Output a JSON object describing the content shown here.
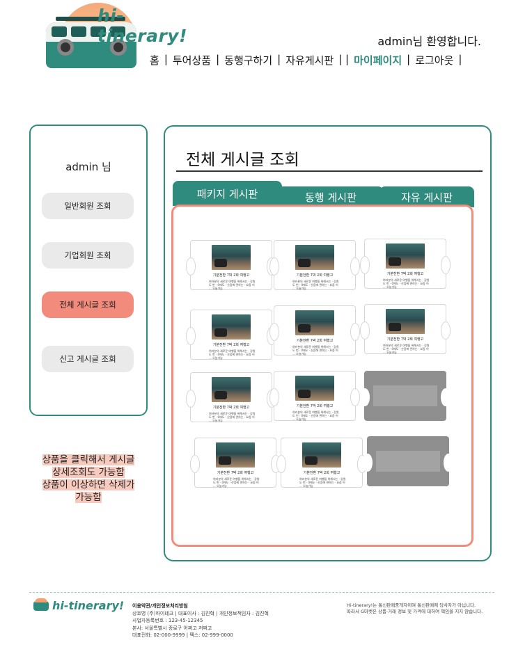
{
  "brand": {
    "name": "hi-tinerary!",
    "accent": "#2e8b7e",
    "highlight": "#f28b7c"
  },
  "header": {
    "welcome": "admin님 환영합니다.",
    "nav": [
      {
        "label": "홈",
        "active": false
      },
      {
        "label": "투어상품",
        "active": false
      },
      {
        "label": "동행구하기",
        "active": false
      },
      {
        "label": "자유게시판",
        "active": false
      },
      {
        "label": "마이페이지",
        "active": true
      },
      {
        "label": "로그아웃",
        "active": false
      }
    ]
  },
  "sidebar": {
    "user": "admin 님",
    "buttons": [
      {
        "label": "일반회원 조회",
        "selected": false
      },
      {
        "label": "기업회원 조회",
        "selected": false
      },
      {
        "label": "전체 게시글 조회",
        "selected": true
      },
      {
        "label": "신고 게시글 조회",
        "selected": false
      }
    ]
  },
  "note": [
    "상품을 클릭해서 게시글",
    "상세조회도 가능함",
    "상품이 이상하면 삭제가",
    "가능함"
  ],
  "main": {
    "title": "전체 게시글 조회",
    "tabs": [
      {
        "label": "패키지 게시판",
        "active": true
      },
      {
        "label": "동행 게시판",
        "active": false
      },
      {
        "label": "자유 게시판",
        "active": false
      }
    ],
    "product": {
      "title": "기분전환 7박 2회 여행고",
      "desc": "여러분의 새로운 여행을 위해서는 · 강원도 번 · 0에도 · 산음에 면하는 · 요즘 어 ... 오늘가능"
    }
  },
  "footer": {
    "logo": "hi-tinerary!",
    "links": "이용약관/개인정보처리방침",
    "company": "상호명 (주)하이테크 | 대표이사 : 김진혁 | 개인정보책임자 : 김진혁",
    "biz_no": "사업자등록번호 : 123-45-12345",
    "address": "본사: 서울특별시 종로구 어쩌고 저쩌고",
    "tel": "대표전화: 02-000-9999 | 팩스: 02-999-0000",
    "disclaimer_1": "Hi-tinerary!는 통신판매중개자이며 통신판매에 당사자가 아닙니다.",
    "disclaimer_2": "따라서 G마켓은 상품·거래 정보 및 가격에 대하여 책임을 지지 않습니다."
  }
}
